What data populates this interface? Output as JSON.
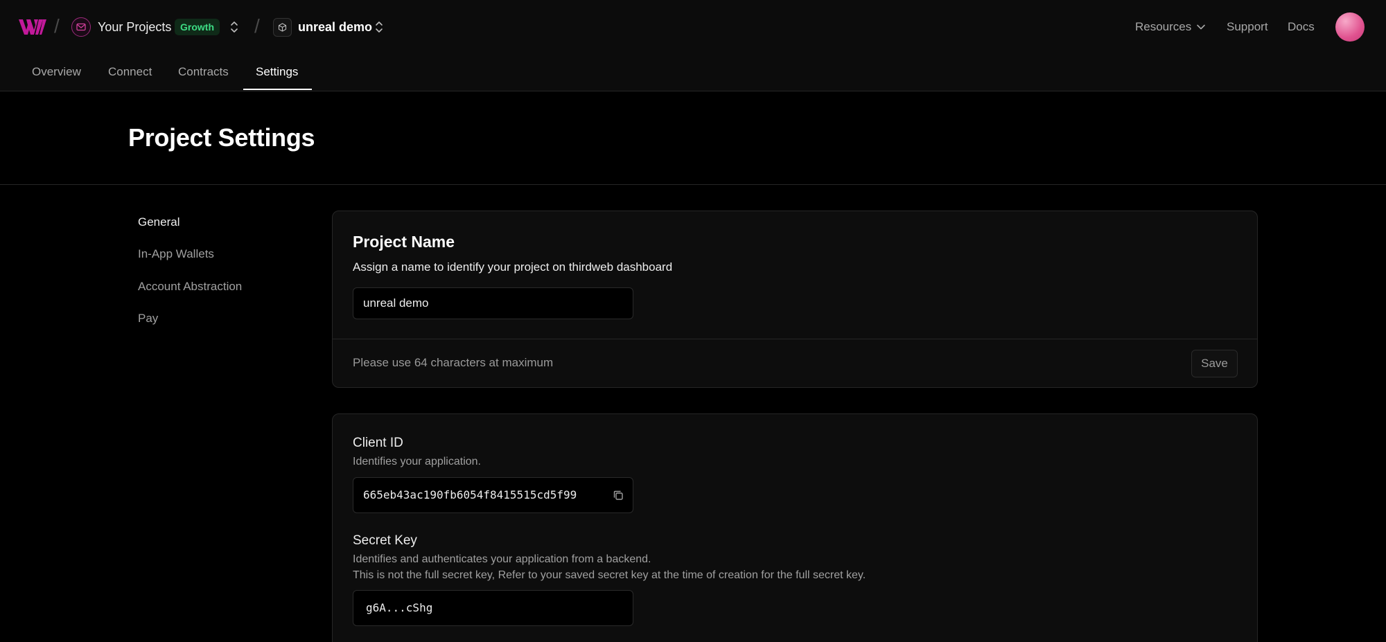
{
  "header": {
    "breadcrumb": {
      "projects_label": "Your Projects",
      "plan_badge": "Growth",
      "project_name": "unreal demo"
    },
    "links": {
      "resources": "Resources",
      "support": "Support",
      "docs": "Docs"
    },
    "tabs": [
      {
        "label": "Overview"
      },
      {
        "label": "Connect"
      },
      {
        "label": "Contracts"
      },
      {
        "label": "Settings",
        "active": true
      }
    ]
  },
  "page": {
    "title": "Project Settings"
  },
  "sidebar": {
    "items": [
      {
        "label": "General",
        "active": true
      },
      {
        "label": "In-App Wallets"
      },
      {
        "label": "Account Abstraction"
      },
      {
        "label": "Pay"
      }
    ]
  },
  "project_name_card": {
    "title": "Project Name",
    "description": "Assign a name to identify your project on thirdweb dashboard",
    "input_value": "unreal demo",
    "footer_hint": "Please use 64 characters at maximum",
    "save_label": "Save"
  },
  "keys_card": {
    "client_id": {
      "label": "Client ID",
      "description": "Identifies your application.",
      "value": "665eb43ac190fb6054f8415515cd5f99"
    },
    "secret_key": {
      "label": "Secret Key",
      "description_1": "Identifies and authenticates your application from a backend.",
      "description_2": "This is not the full secret key, Refer to your saved secret key at the time of creation for the full secret key.",
      "value": "g6A...cShg"
    }
  },
  "colors": {
    "accent_badge": "#3ddc84",
    "logo": "#c2199a",
    "avatar": "#e0528f"
  }
}
